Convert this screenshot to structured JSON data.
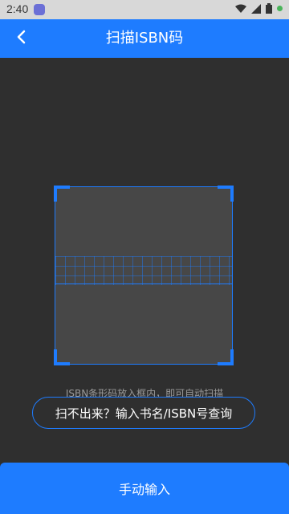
{
  "status_bar": {
    "time": "2:40",
    "icons": [
      "wifi-icon",
      "signal-icon",
      "battery-icon"
    ]
  },
  "header": {
    "title": "扫描ISBN码",
    "back_icon": "chevron-left-icon"
  },
  "scanner": {
    "hint": "ISBN条形码放入框内，即可自动扫描"
  },
  "buttons": {
    "manual_query": "扫不出来？输入书名/ISBN号查询",
    "manual_input": "手动输入"
  },
  "colors": {
    "accent": "#1e7cff",
    "background": "#2f2f2f",
    "scan_area": "#474747"
  }
}
